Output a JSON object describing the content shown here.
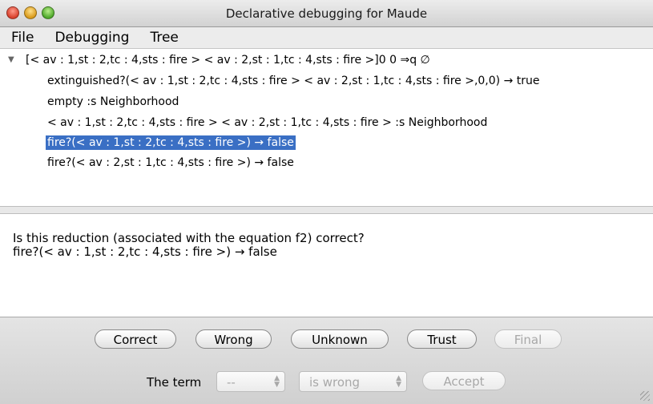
{
  "window": {
    "title": "Declarative debugging for Maude"
  },
  "menubar": {
    "items": [
      "File",
      "Debugging",
      "Tree"
    ]
  },
  "tree": {
    "root": "[< av : 1,st : 2,tc : 4,sts : fire > < av : 2,st : 1,tc : 4,sts : fire >]0 0 ⇒q ∅",
    "children": [
      "extinguished?(< av : 1,st : 2,tc : 4,sts : fire > < av : 2,st : 1,tc : 4,sts : fire >,0,0) → true",
      "empty :s  Neighborhood",
      "< av : 1,st : 2,tc : 4,sts : fire > < av : 2,st : 1,tc : 4,sts : fire > :s  Neighborhood",
      "fire?(< av : 1,st : 2,tc : 4,sts : fire >) → false",
      "fire?(< av : 2,st : 1,tc : 4,sts : fire >) → false"
    ],
    "selected_index": 3
  },
  "question": {
    "text": "Is this reduction (associated with the equation f2) correct?",
    "expression": "fire?(< av : 1,st : 2,tc : 4,sts : fire >) → false"
  },
  "buttons": {
    "correct": "Correct",
    "wrong": "Wrong",
    "unknown": "Unknown",
    "trust": "Trust",
    "final": "Final",
    "accept": "Accept"
  },
  "term_row": {
    "label": "The term",
    "term_select": "--",
    "verdict_select": "is wrong"
  },
  "colors": {
    "selection": "#3a6fc4"
  },
  "icons": [
    "close-light-icon",
    "minimize-light-icon",
    "zoom-light-icon",
    "disclosure-triangle-icon",
    "stepper-icon",
    "resize-grip-icon"
  ]
}
